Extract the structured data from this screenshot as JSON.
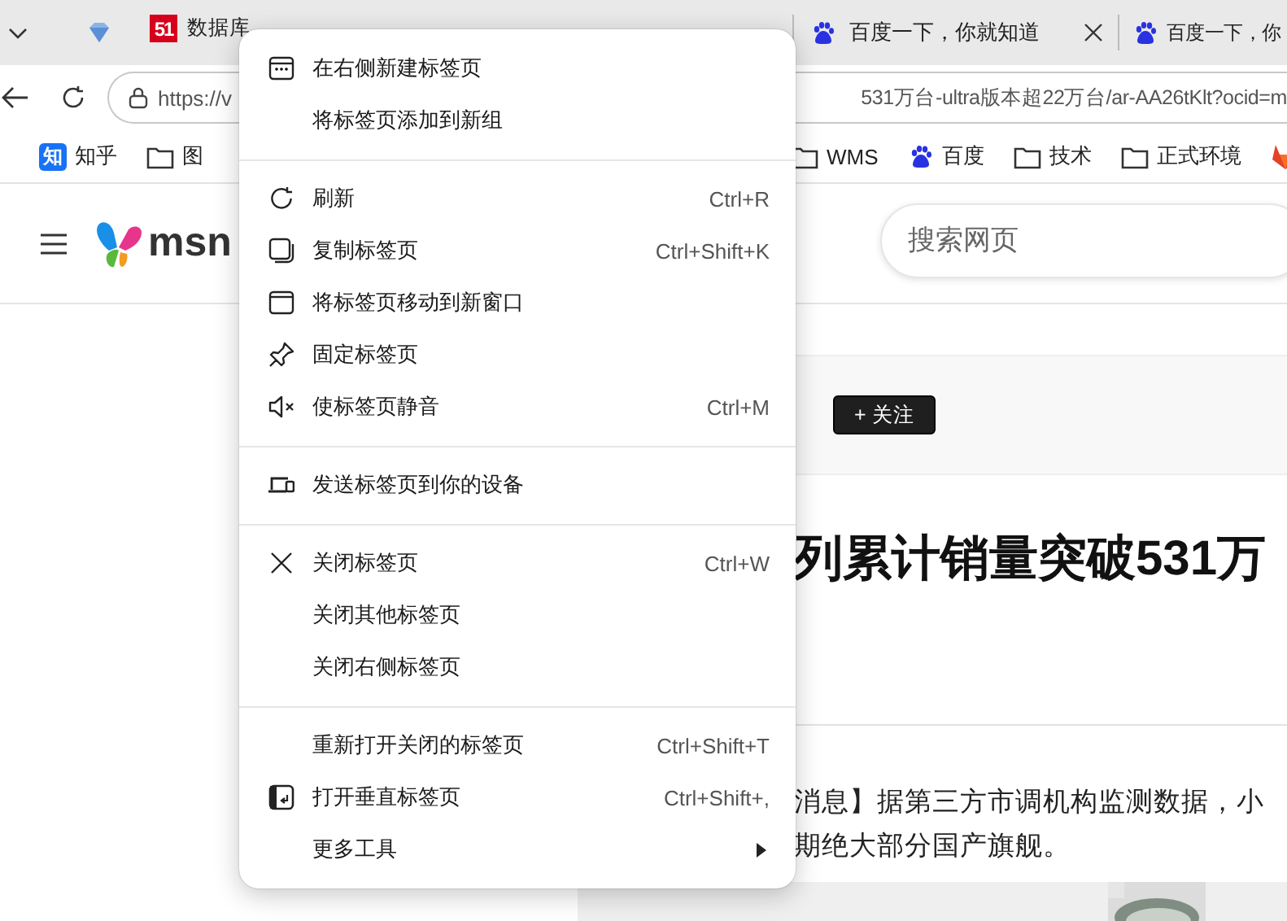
{
  "tab_strip": {
    "tabs": [
      {
        "kind": "pinned",
        "selected": false
      },
      {
        "kind": "badge",
        "icon_text": "51",
        "title": "数据库",
        "selected": false
      },
      {
        "kind": "paw",
        "title": "百度一下，你就知道",
        "selected": false
      },
      {
        "kind": "paw",
        "title": "百度一下，你",
        "selected": false
      }
    ]
  },
  "toolbar": {
    "url_start": "https://v",
    "url_end": "531万台-ultra版本超22万台/ar-AA26tKlt?ocid=m"
  },
  "bookmarks": [
    {
      "kind": "badge",
      "icon_text": "知",
      "label": "知乎"
    },
    {
      "kind": "folder",
      "label": "图"
    },
    {
      "kind": "folder",
      "label": "WMS"
    },
    {
      "kind": "paw",
      "label": "百度"
    },
    {
      "kind": "folder",
      "label": "技术"
    },
    {
      "kind": "folder",
      "label": "正式环境"
    },
    {
      "kind": "fox"
    }
  ],
  "msn_header": {
    "logo": "msn",
    "search": {
      "placeholder": "搜索网页"
    }
  },
  "article": {
    "follow_button": "+ 关注",
    "title": "列累计销量突破531万",
    "body_lines": [
      "消息】据第三方市调机构监测数据，小",
      "期绝大部分国产旗舰。"
    ]
  },
  "context_menu": {
    "groups": [
      [
        {
          "label": "在右侧新建标签页",
          "submenu": false
        },
        {
          "label": "将标签页添加到新组",
          "submenu": false
        }
      ],
      [
        {
          "label": "刷新",
          "shortcut": "Ctrl+R",
          "submenu": false
        },
        {
          "label": "复制标签页",
          "shortcut": "Ctrl+Shift+K",
          "submenu": false
        },
        {
          "label": "将标签页移动到新窗口",
          "submenu": false
        },
        {
          "label": "固定标签页",
          "submenu": false
        },
        {
          "label": "使标签页静音",
          "shortcut": "Ctrl+M",
          "submenu": false
        }
      ],
      [
        {
          "label": "发送标签页到你的设备",
          "submenu": false
        }
      ],
      [
        {
          "label": "关闭标签页",
          "shortcut": "Ctrl+W",
          "submenu": false
        },
        {
          "label": "关闭其他标签页",
          "submenu": false
        },
        {
          "label": "关闭右侧标签页",
          "submenu": false
        }
      ],
      [
        {
          "label": "重新打开关闭的标签页",
          "shortcut": "Ctrl+Shift+T",
          "submenu": false
        },
        {
          "label": "打开垂直标签页",
          "shortcut": "Ctrl+Shift+,",
          "submenu": false
        },
        {
          "label": "更多工具",
          "submenu": true
        }
      ]
    ]
  }
}
